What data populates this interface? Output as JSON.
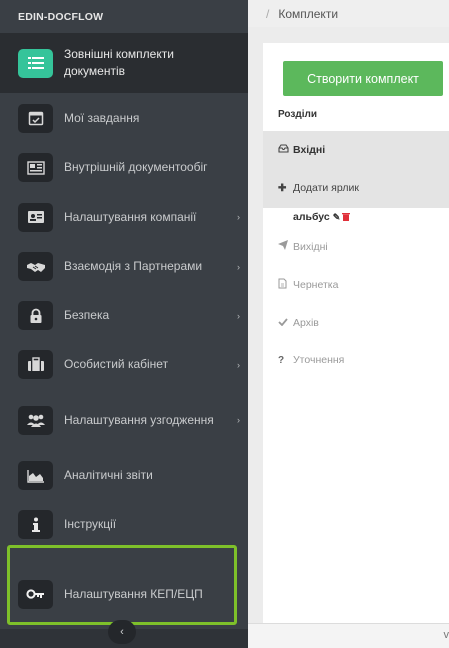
{
  "brand": "EDIN-DOCFLOW",
  "breadcrumb": {
    "separator": "/",
    "current": "Комплекти"
  },
  "sidebar": {
    "items": [
      {
        "label": "Зовнішні комплекти документів",
        "icon": "list-icon",
        "active": true
      },
      {
        "label": "Мої завдання",
        "icon": "calendar-check-icon"
      },
      {
        "label": "Внутрішній документообіг",
        "icon": "newspaper-icon"
      },
      {
        "label": "Налаштування компанії",
        "icon": "id-card-icon",
        "arrow": "›"
      },
      {
        "label": "Взаємодія з Партнерами",
        "icon": "handshake-icon",
        "arrow": "›"
      },
      {
        "label": "Безпека",
        "icon": "lock-icon",
        "arrow": "›"
      },
      {
        "label": "Особистий кабінет",
        "icon": "briefcase-icon",
        "arrow": "›"
      },
      {
        "label": "Налаштування узгодження",
        "icon": "users-icon",
        "arrow": "›"
      },
      {
        "label": "Аналітичні звіти",
        "icon": "area-chart-icon"
      },
      {
        "label": "Інструкції",
        "icon": "info-icon"
      },
      {
        "label": "Налаштування КЕП/ЕЦП",
        "icon": "key-icon"
      }
    ],
    "collapse": "‹"
  },
  "main": {
    "create_button": "Створити комплект",
    "sections_header": "Розділи",
    "inbox": "Вхідні",
    "add_label": "Додати ярлик",
    "label_item": "альбус",
    "outbox": "Вихідні",
    "draft": "Чернетка",
    "archive": "Архів",
    "clarification": "Уточнення"
  },
  "footer": {
    "text": "v"
  },
  "colors": {
    "sidebar_bg": "#3a3f45",
    "active_icon": "#35c49a",
    "create_button": "#5cb85c",
    "highlight": "#7ec02a",
    "delete": "#e0303a"
  }
}
